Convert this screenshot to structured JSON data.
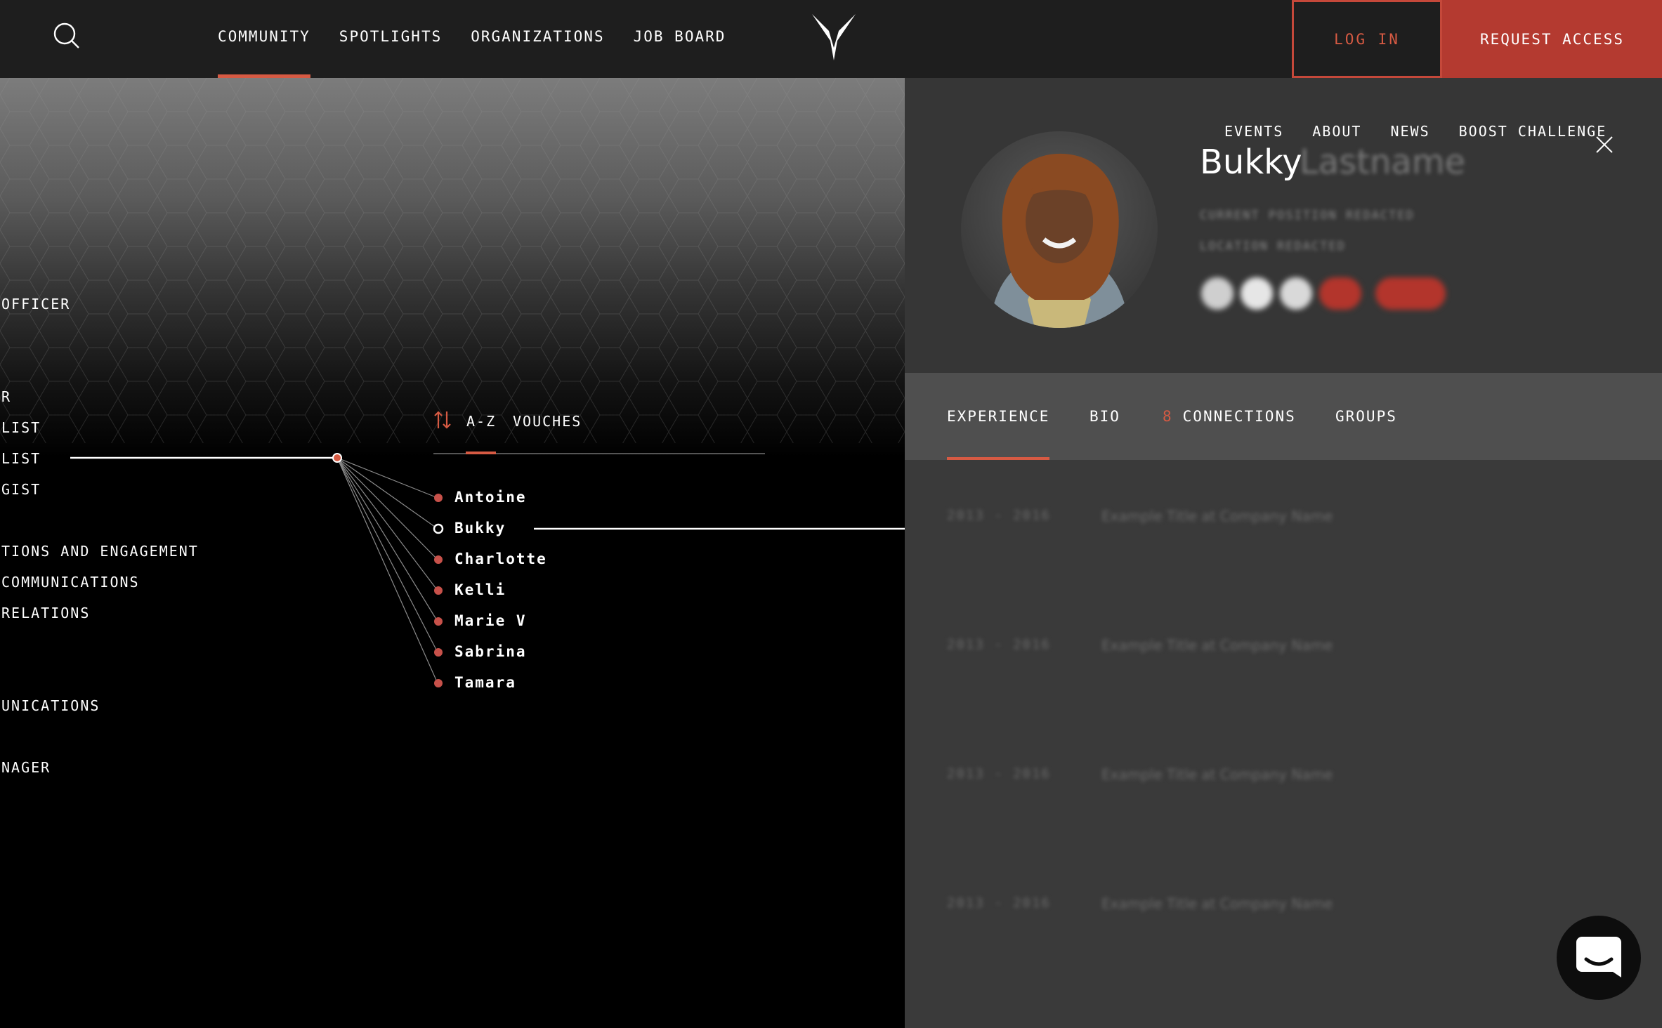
{
  "header": {
    "nav": [
      "COMMUNITY",
      "SPOTLIGHTS",
      "ORGANIZATIONS",
      "JOB BOARD"
    ],
    "active_nav": "COMMUNITY",
    "login_label": "LOG IN",
    "request_label": "REQUEST ACCESS"
  },
  "titles": [
    "OFFICER",
    "R",
    "LIST",
    "LIST",
    "GIST",
    "TIONS AND ENGAGEMENT",
    " COMMUNICATIONS",
    "RELATIONS",
    "UNICATIONS",
    "NAGER"
  ],
  "sort": {
    "az_label": "A-Z",
    "vouches_label": "VOUCHES"
  },
  "people": [
    "Antoine",
    "Bukky",
    "Charlotte",
    "Kelli",
    "Marie V",
    "Sabrina",
    "Tamara"
  ],
  "selected_person": "Bukky",
  "profile": {
    "sub_nav": [
      "EVENTS",
      "ABOUT",
      "NEWS",
      "BOOST CHALLENGE"
    ],
    "first_name": "Bukky",
    "last_name": "Lastname",
    "position": "CURRENT POSITION REDACTED",
    "location": "LOCATION REDACTED",
    "tabs": {
      "experience": "EXPERIENCE",
      "bio": "BIO",
      "connections_count": "8",
      "connections": "CONNECTIONS",
      "groups": "GROUPS"
    },
    "experience": [
      {
        "years": "2013 - 2016",
        "title": "Example Title at Company Name"
      },
      {
        "years": "2013 - 2016",
        "title": "Example Title at Company Name"
      },
      {
        "years": "2013 - 2016",
        "title": "Example Title at Company Name"
      },
      {
        "years": "2013 - 2016",
        "title": "Example Title at Company Name"
      }
    ]
  },
  "colors": {
    "accent": "#d65a43",
    "button": "#b43a30",
    "panel": "#3a3a3a",
    "header": "#1e1e1e"
  }
}
